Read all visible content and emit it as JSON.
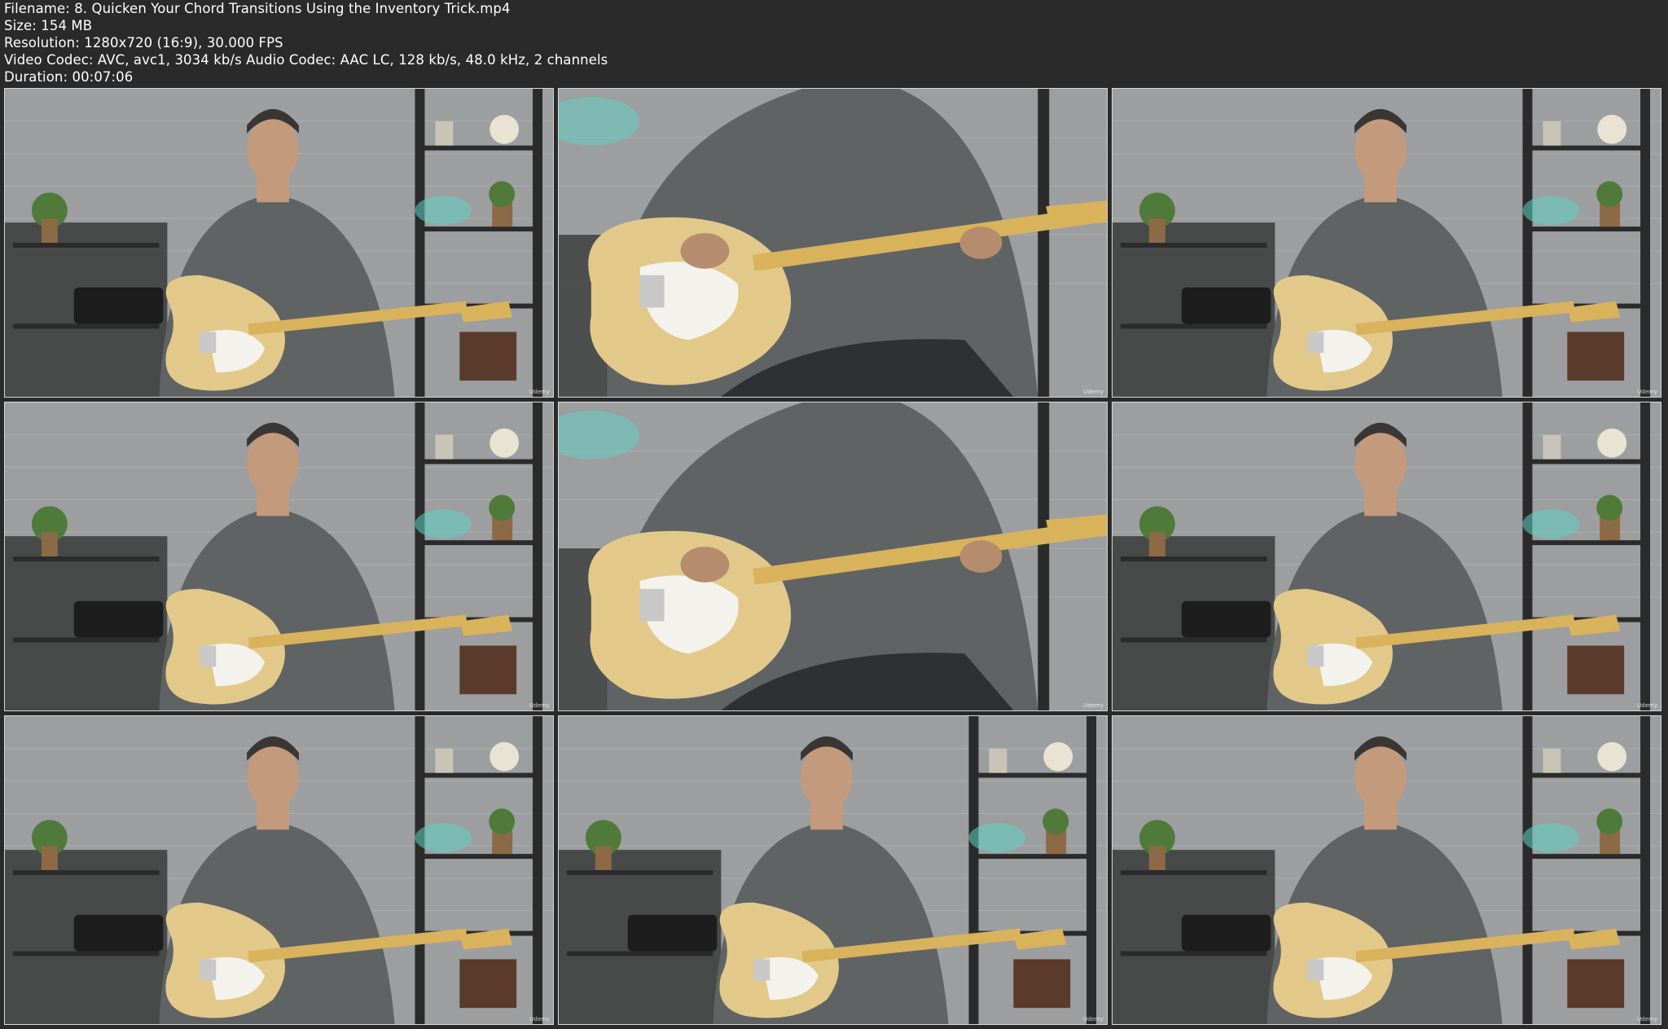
{
  "info": {
    "filename": "Filename: 8. Quicken Your Chord Transitions Using the Inventory Trick.mp4",
    "size": "Size: 154 MB",
    "resolution": "Resolution: 1280x720 (16:9), 30.000 FPS",
    "codecs": "Video Codec: AVC, avc1, 3034 kb/s Audio Codec: AAC LC, 128 kb/s, 48.0 kHz, 2 channels",
    "duration": "Duration: 00:07:06"
  },
  "thumbnails": [
    {
      "shot": "wide",
      "watermark": "Udemy"
    },
    {
      "shot": "closeup",
      "watermark": "Udemy"
    },
    {
      "shot": "wide",
      "watermark": "Udemy"
    },
    {
      "shot": "wide",
      "watermark": "Udemy"
    },
    {
      "shot": "closeup",
      "watermark": "Udemy"
    },
    {
      "shot": "wide",
      "watermark": "Udemy"
    },
    {
      "shot": "wide",
      "watermark": "Udemy"
    },
    {
      "shot": "wide",
      "watermark": "Udemy"
    },
    {
      "shot": "wide",
      "watermark": "Udemy"
    }
  ],
  "colors": {
    "background": "#2a2a2a",
    "text": "#ffffff",
    "wall": "#9c9ea0",
    "shirt": "#5f6364",
    "guitar_body": "#e2c98a",
    "pickguard": "#f4f2ec",
    "neck": "#d9b25c",
    "shelf": "#2b2b2b",
    "teal_glow": "#5fd1c3"
  }
}
